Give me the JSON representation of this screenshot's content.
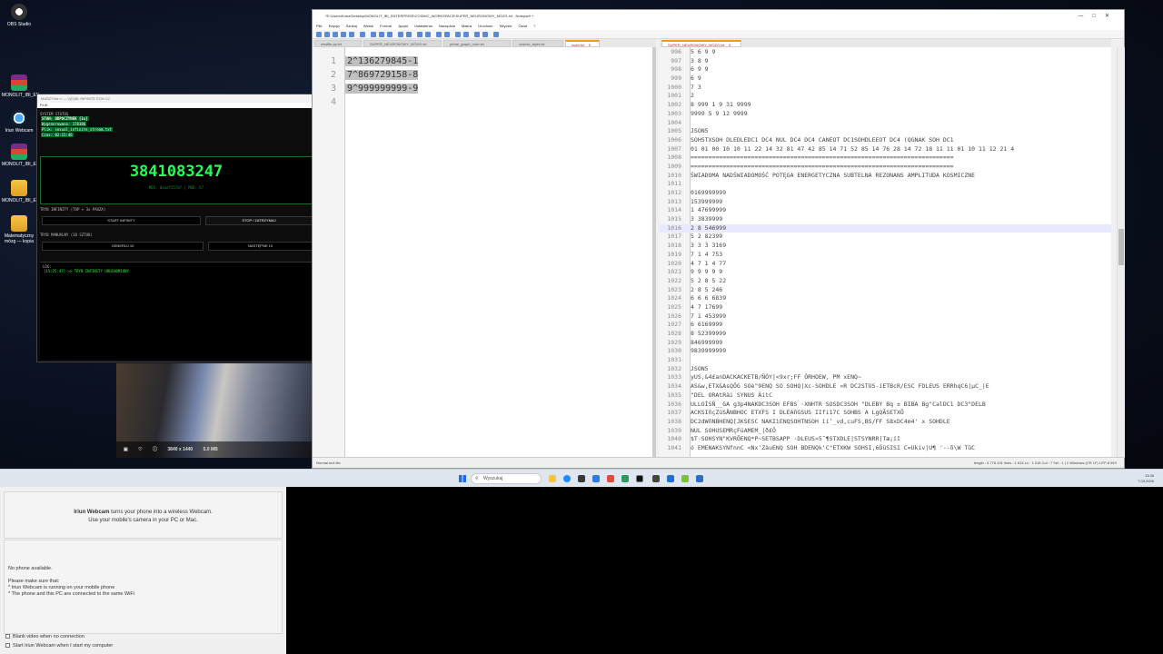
{
  "desktop": {
    "icons": [
      {
        "label": "OBS Studio"
      },
      {
        "label": "MONOLIT_IBI_EN..."
      },
      {
        "label": "Iriun Webcam"
      },
      {
        "label": "MONOLIT_IBI_EN..."
      },
      {
        "label": "MONOLIT_IBI_EN..."
      },
      {
        "label": "Matematyczny mózg — kopia"
      }
    ]
  },
  "machine": {
    "title": "MASZYNA ∞ — V(D)BL INFINITE EON V2",
    "menu": "PLIK",
    "section_status": "SYSTEM STATUS",
    "state": "STAN: ODPOCZYNEK [1s]",
    "generated": "Wygenerowano: 178386",
    "file": "Plik: sexual_infinite_stream.txt",
    "time": "Czas: 02:15:46",
    "big_number": "3841083247",
    "hash": "MD5: 0xaef2576f | MOD: 67",
    "section_infinite": "TRYB INFINITY (TOP + 3x PAUZA)",
    "btn_start": "START INFINITY",
    "btn_stop": "STOP / ZATRZYMAJ",
    "section_manual": "TRYB MANUALNY (10 SZTUK)",
    "btn_generate": "GENERUJ 10",
    "btn_next": "NASTĘPNE 10",
    "log_label": "LOG:",
    "log_line": "[15:25:47] >> TRYB INFINITY URUCHOMIONY"
  },
  "video": {
    "info": "3840 x 1440",
    "size": "5.0 MB"
  },
  "npp": {
    "title": "*E:\\Users\\Kuba\\Desktop\\MONOLIT_IBI_ENTERPRISE\\COSMIC_WORKSPACE\\SUPER_NEURONOWY_MÓZG.txt - Notepad++",
    "menu": [
      "Plik",
      "Edycja",
      "Szukaj",
      "Widok",
      "Format",
      "Języki",
      "Ustawienia",
      "Narzędzia",
      "Makra",
      "Uruchom",
      "Wtyczki",
      "Okna",
      "?"
    ],
    "tabs_left": [
      "newfile.py.txt",
      "SUPER_NEURONOWY_MÓZG.txt",
      "prime_graph_core.txt",
      "cosmic_layer.txt",
      "math.txt"
    ],
    "tab_right": "SUPER_NEURONOWY_MÓZG.txt",
    "left_lines": [
      {
        "n": "1",
        "t": "2^136279845-1"
      },
      {
        "n": "2",
        "t": "7^869729158-8"
      },
      {
        "n": "3",
        "t": "9^999999999-9"
      },
      {
        "n": "4",
        "t": ""
      }
    ],
    "right_lines": [
      {
        "n": "996",
        "t": "5 6       9 9"
      },
      {
        "n": "997",
        "t": "  3       8 9"
      },
      {
        "n": "998",
        "t": "6     9    9"
      },
      {
        "n": "999",
        "t": "  6        9"
      },
      {
        "n": "1000",
        "t": "7 3"
      },
      {
        "n": "1001",
        "t": "  2"
      },
      {
        "n": "1002",
        "t": "8 999 1 9 31 9999"
      },
      {
        "n": "1003",
        "t": "9999 5 9 12 9999"
      },
      {
        "n": "1004",
        "t": ""
      },
      {
        "n": "1005",
        "t": "JSON5"
      },
      {
        "n": "1006",
        "t": "SOHSTXSOH DLEDLEDC1 DC4 NUL  DC4 DC4 CANEOT DC1SOHDLEEOT DC4 (QGNAK SOH DC1"
      },
      {
        "n": "1007",
        "t": "01 01 00 10 10 11 22 14 32 81 47 42 85 14 71 52 85 14 76 28 14 72 18 11 11 01 10 11 12 21 4"
      },
      {
        "n": "1008",
        "t": "=========================================================================="
      },
      {
        "n": "1009",
        "t": "=========================================================================="
      },
      {
        "n": "1010",
        "t": "ŚWIADOMA NADŚWIADOMOŚĆ POTĘGA ENERGETYCZNA SUBTELNA REZONANS AMPLITUDA KOSMICZNE"
      },
      {
        "n": "1011",
        "t": ""
      },
      {
        "n": "1012",
        "t": "0169999999"
      },
      {
        "n": "1013",
        "t": " 153999999"
      },
      {
        "n": "1014",
        "t": "1 47699999"
      },
      {
        "n": "1015",
        "t": "  3 3839999"
      },
      {
        "n": "1016",
        "t": "2 8 546999"
      },
      {
        "n": "1017",
        "t": "  5 2 82399"
      },
      {
        "n": "1018",
        "t": "3 3 3 3169"
      },
      {
        "n": "1019",
        "t": "  7 1 4 753"
      },
      {
        "n": "1020",
        "t": "4 7 1 4 77"
      },
      {
        "n": "1021",
        "t": "  9 9 9 9 9"
      },
      {
        "n": "1022",
        "t": "5 2 8 5 22"
      },
      {
        "n": "1023",
        "t": "  2 8 5 246"
      },
      {
        "n": "1024",
        "t": "6 6 6 6839"
      },
      {
        "n": "1025",
        "t": "  4 7 17699"
      },
      {
        "n": "1026",
        "t": "7 1 453999"
      },
      {
        "n": "1027",
        "t": "  6 6169999"
      },
      {
        "n": "1028",
        "t": "8 52399999"
      },
      {
        "n": "1029",
        "t": " 846999999"
      },
      {
        "n": "1030",
        "t": "9839999999"
      },
      {
        "n": "1031",
        "t": ""
      },
      {
        "n": "1032",
        "t": "JSON5"
      },
      {
        "n": "1033",
        "t": "  yUS,&4£anDACKACKETB/ÑÓY|<9xr;FF ÓRHOEW,    PM   xENQ~"
      },
      {
        "n": "1034",
        "t": "AS&w,ETX&AsQÖG  SOè\"9ENQ SO SOHQ|Xc-SOHDLE »R DC2STUS-iETBcR/ESC FDLEUS ERRhqC6|µC_|E"
      },
      {
        "n": "1035",
        "t": "  \"DEL ORAtRài  SYNUS ÄitC"
      },
      {
        "n": "1036",
        "t": "ULLOÌSÑ__GA g3p4NAKDC3SOH EFBS ·XNHTR SOSDC3SOH \"DLEBY Bq ± BIBA   Bg\"CalDC1 DC3\"DELB"
      },
      {
        "n": "1037",
        "t": "ACKSIñçZüSÅNBHOC ETXFS I DLEAñGSUS IIfi17C SOHBS A LgQÃSETXÕ"
      },
      {
        "n": "1038",
        "t": "  DC2dWñNBHENQ[JKSESC NAKIìENQSOHTNSOH ìí’_vd,cuFS,BS/FF S8xDC4m4' x SOHDLE"
      },
      {
        "n": "1039",
        "t": "  NUL SOHUSEMRçFüAMEM_|ð£Ö"
      },
      {
        "n": "1040",
        "t": "  $T·SOHSYN\"KVRÕENQ*P~SETBSAPP ·DLEUS»5˜¶STXDLE|STSYNRR|Tæ¡íî"
      },
      {
        "n": "1041",
        "t": "  ó EMENAKSYNfnnC <Nx'ZàuENQ SOH BDENQk'C\"ETXKW SOHSI,6ÖüSISI C=Ukiv|U¶   '--õ\\W  TüC"
      }
    ],
    "status_left": "Normal text file",
    "status_right": "length : 5 778 101   lines : 1 615     Ln : 1 016   Col : 7   Sel : 1 | 1        Windows (CR LF)    UTF-8          INS"
  },
  "taskbar": {
    "search": "Wyszukaj",
    "time": "13:36",
    "date": "7.03.2026"
  },
  "iriun": {
    "brand": "Iriun Webcam",
    "line1": "turns your phone into a wireless Webcam.",
    "line2": "Use your mobile's camera in your PC or Mac.",
    "no_phone": "No phone available.",
    "make_sure": "Please make sure that:",
    "req1": "* Iriun Webcam is running on your mobile phone",
    "req2": "* The phone and this PC are connected to the same WiFi",
    "check1": "Blank video when no connection",
    "check2": "Start Iriun Webcam when I start my computer"
  }
}
